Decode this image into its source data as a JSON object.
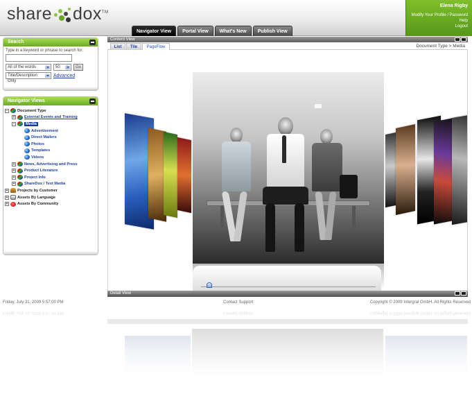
{
  "app": {
    "logo_left": "share",
    "logo_right": "dox",
    "logo_tm": "TM"
  },
  "tabs": [
    {
      "label": "Navigator View",
      "active": true
    },
    {
      "label": "Portal View",
      "active": false
    },
    {
      "label": "What's New",
      "active": false
    },
    {
      "label": "Publish View",
      "active": false
    }
  ],
  "user": {
    "name": "Elena Rigby",
    "modify": "Modify Your Profile / Password",
    "help": "Help",
    "logout": "Logout"
  },
  "search": {
    "title": "Search",
    "hint": "Type in a keyword or phrase to search for:",
    "value": "",
    "match_mode": "All of the words",
    "page_size": "50",
    "go_label": "Go",
    "scope": "Title/Description Only",
    "advanced_label": "Advanced"
  },
  "navigator": {
    "title": "Navigator Views",
    "tree": [
      {
        "label": "Document Type",
        "toggle": "−",
        "icon": "folder",
        "indent": 0,
        "link": false
      },
      {
        "label": "External Events and Training",
        "toggle": "+",
        "icon": "folder",
        "indent": 1,
        "link": true,
        "underline": true
      },
      {
        "label": "Media",
        "toggle": "−",
        "icon": "folder",
        "indent": 1,
        "link": true,
        "selected": true
      },
      {
        "label": "Advertisement",
        "toggle": "",
        "icon": "globe",
        "indent": 2,
        "link": true
      },
      {
        "label": "Direct Mailers",
        "toggle": "",
        "icon": "globe",
        "indent": 2,
        "link": true
      },
      {
        "label": "Photos",
        "toggle": "",
        "icon": "globe",
        "indent": 2,
        "link": true
      },
      {
        "label": "Templates",
        "toggle": "",
        "icon": "globe",
        "indent": 2,
        "link": true
      },
      {
        "label": "Videos",
        "toggle": "",
        "icon": "globe",
        "indent": 2,
        "link": true
      },
      {
        "label": "News, Advertising and Press",
        "toggle": "+",
        "icon": "folder",
        "indent": 1,
        "link": true
      },
      {
        "label": "Product Literature",
        "toggle": "+",
        "icon": "folder",
        "indent": 1,
        "link": true
      },
      {
        "label": "Project Info",
        "toggle": "+",
        "icon": "folder",
        "indent": 1,
        "link": true
      },
      {
        "label": "ShareDox / Text Media",
        "toggle": "+",
        "icon": "folder",
        "indent": 1,
        "link": true
      },
      {
        "label": "Projects by Customer",
        "toggle": "+",
        "icon": "people",
        "indent": 0,
        "link": false
      },
      {
        "label": "Assets By Language",
        "toggle": "+",
        "icon": "lang",
        "indent": 0,
        "link": false
      },
      {
        "label": "Assets By Community",
        "toggle": "+",
        "icon": "comm",
        "indent": 0,
        "link": false
      }
    ]
  },
  "content": {
    "bar_title": "Content View",
    "view_tabs": [
      {
        "label": "List",
        "active": false
      },
      {
        "label": "Tile",
        "active": false
      },
      {
        "label": "PageFlow",
        "active": true
      }
    ],
    "breadcrumb": "Document Type   >   Media",
    "detail_title": "Detail View",
    "slider_value": 0.03
  },
  "footer": {
    "datetime": "Friday, July 31, 2009 5:57:00 PM",
    "contact": "Contact Support",
    "copyright": "Copyright © 2009 Intergral GmbH. All Rights Reserved"
  },
  "colors": {
    "brand_green": "#7fbf2a",
    "dark_tab": "#000000",
    "link_blue": "#1f3f9f",
    "selected_blue": "#123c9c"
  }
}
